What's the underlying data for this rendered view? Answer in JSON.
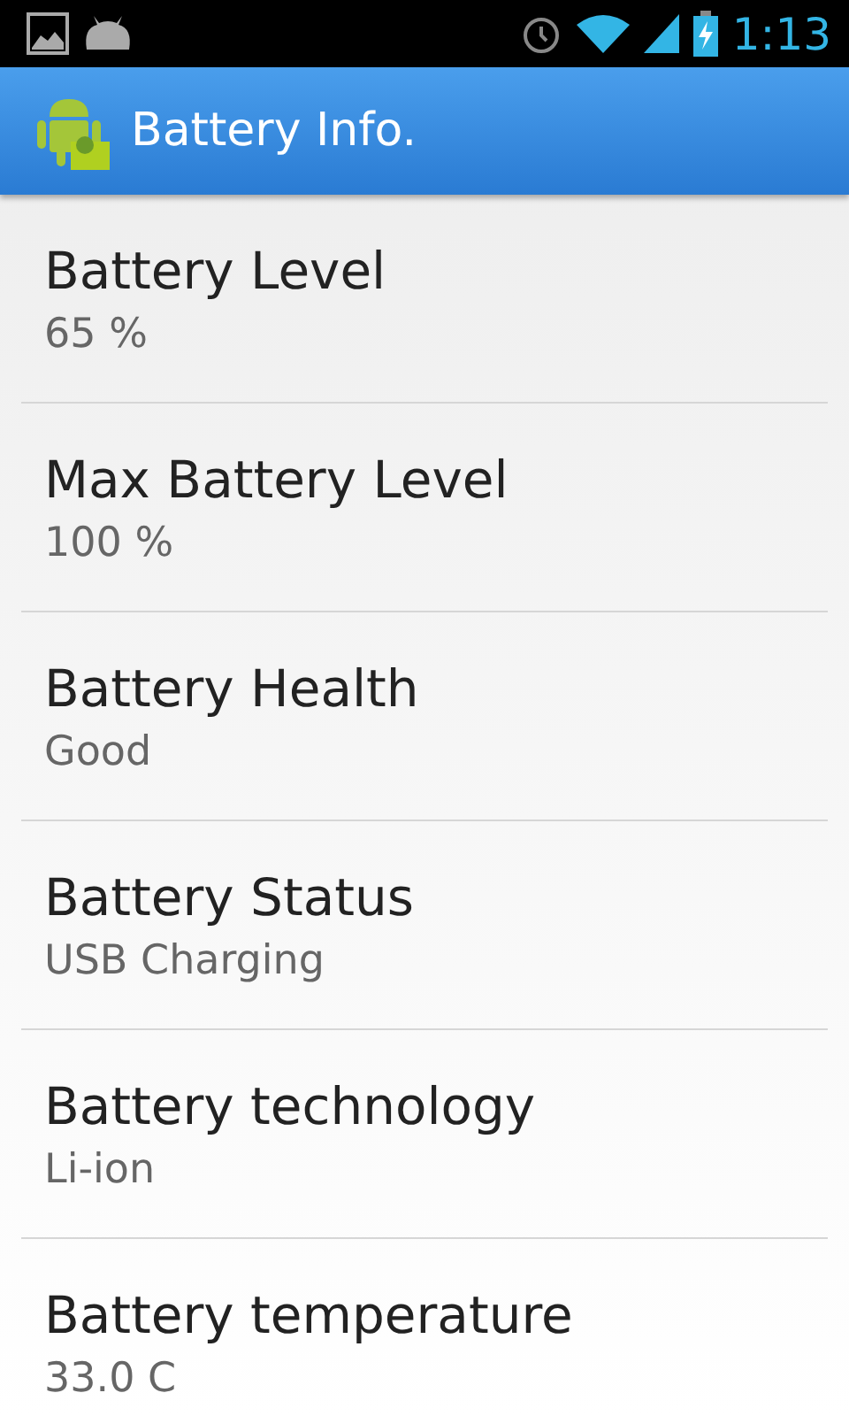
{
  "status_bar": {
    "time": "1:13"
  },
  "app_bar": {
    "title": "Battery Info."
  },
  "items": [
    {
      "label": "Battery Level",
      "value": "65 %"
    },
    {
      "label": "Max Battery Level",
      "value": "100 %"
    },
    {
      "label": "Battery Health",
      "value": "Good"
    },
    {
      "label": "Battery Status",
      "value": "USB Charging"
    },
    {
      "label": "Battery technology",
      "value": "Li-ion"
    },
    {
      "label": "Battery temperature",
      "value": "33.0 C"
    }
  ]
}
